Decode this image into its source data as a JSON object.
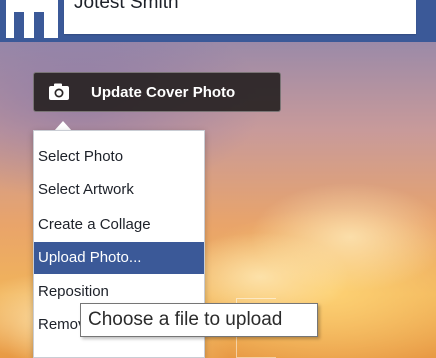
{
  "profile": {
    "name": "Jotest Smith"
  },
  "cover": {
    "update_button_label": "Update Cover Photo",
    "camera_icon": "camera-icon"
  },
  "menu": {
    "items": [
      {
        "label": "Select Photo"
      },
      {
        "label": "Select Artwork"
      },
      {
        "label": "Create a Collage"
      },
      {
        "label": "Upload Photo..."
      },
      {
        "label": "Reposition"
      },
      {
        "label": "Remove"
      }
    ],
    "active_item": "Upload Photo..."
  },
  "tooltip": {
    "text": "Choose a file to upload"
  },
  "colors": {
    "brand_blue": "#3b5998",
    "menu_highlight": "#3b5998",
    "button_bg": "#282323"
  }
}
